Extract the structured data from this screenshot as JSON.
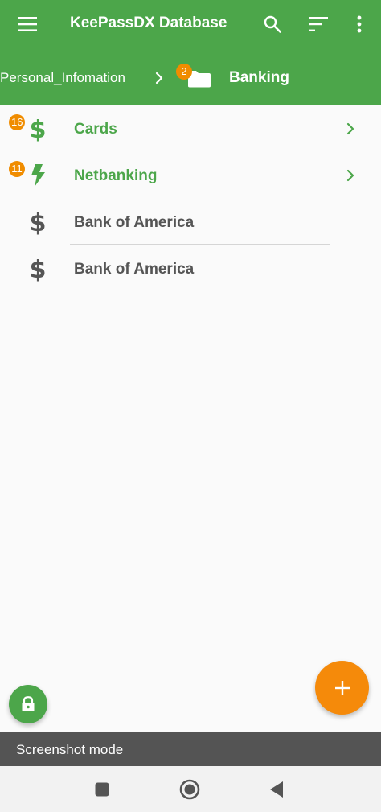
{
  "toolbar": {
    "title": "KeePassDX Database",
    "menu_icon": "hamburger-menu-icon",
    "search_icon": "search-icon",
    "sort_icon": "sort-icon",
    "more_icon": "more-vert-icon"
  },
  "breadcrumb": {
    "parent_label": "Personal_Infomation",
    "separator_icon": "chevron-right-icon",
    "current_group_badge": "2",
    "current_group_icon": "folder-icon",
    "current_label": "Banking"
  },
  "list": {
    "items": [
      {
        "label": "Cards",
        "type": "group",
        "badge": "16",
        "icon": "dollar-icon",
        "has_chevron": true
      },
      {
        "label": "Netbanking",
        "type": "group",
        "badge": "11",
        "icon": "lightning-bolt-icon",
        "has_chevron": true
      },
      {
        "label": "Bank of America",
        "type": "entry",
        "icon": "dollar-icon",
        "has_chevron": false
      },
      {
        "label": "Bank of America",
        "type": "entry",
        "icon": "dollar-icon",
        "has_chevron": false
      }
    ]
  },
  "fab": {
    "add_icon": "plus-icon",
    "lock_icon": "lock-icon"
  },
  "snackbar": {
    "text": "Screenshot mode"
  },
  "navbar": {
    "recents_icon": "square-icon",
    "home_icon": "circle-icon",
    "back_icon": "triangle-back-icon"
  },
  "colors": {
    "primary": "#4CA64A",
    "accent": "#F58A0A",
    "badge": "#F08C00",
    "entry_text": "#555555",
    "background": "#FAFAFA"
  }
}
